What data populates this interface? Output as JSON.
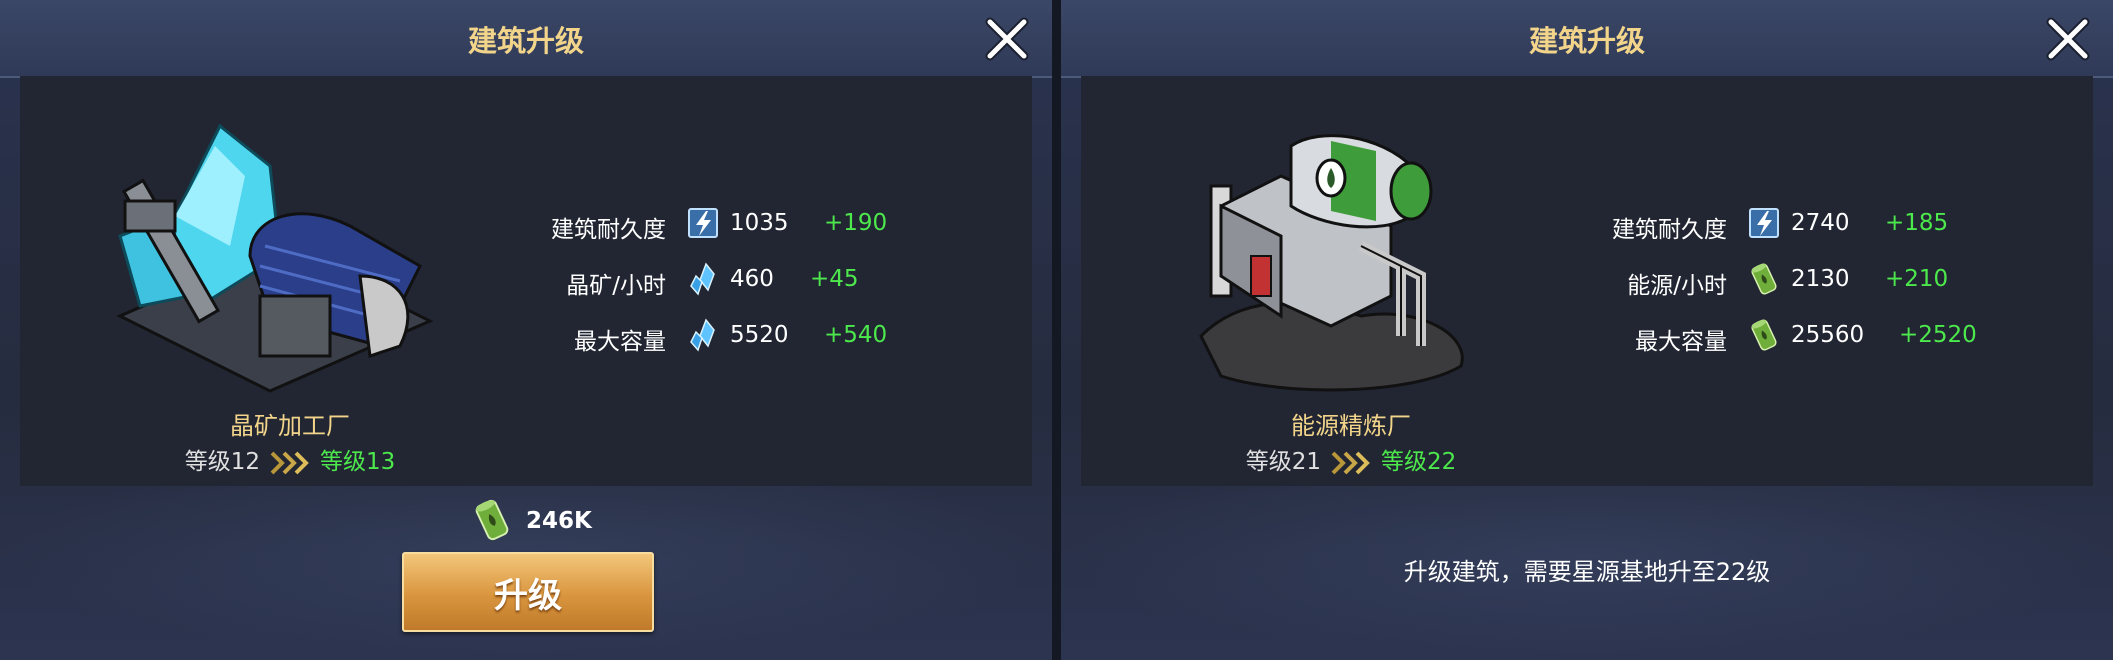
{
  "panels": [
    {
      "title": "建筑升级",
      "building_name": "晶矿加工厂",
      "level_from": "等级12",
      "level_to": "等级13",
      "stats": [
        {
          "label": "建筑耐久度",
          "icon": "durability-icon",
          "value": "1035",
          "bonus": "+190"
        },
        {
          "label": "晶矿/小时",
          "icon": "crystal-icon",
          "value": "460",
          "bonus": "+45"
        },
        {
          "label": "最大容量",
          "icon": "crystal-icon",
          "value": "5520",
          "bonus": "+540"
        }
      ],
      "cost": {
        "icon": "energy-barrel-icon",
        "amount": "246K"
      },
      "button_label": "升级"
    },
    {
      "title": "建筑升级",
      "building_name": "能源精炼厂",
      "level_from": "等级21",
      "level_to": "等级22",
      "stats": [
        {
          "label": "建筑耐久度",
          "icon": "durability-icon",
          "value": "2740",
          "bonus": "+185"
        },
        {
          "label": "能源/小时",
          "icon": "energy-barrel-icon",
          "value": "2130",
          "bonus": "+210"
        },
        {
          "label": "最大容量",
          "icon": "energy-barrel-icon",
          "value": "25560",
          "bonus": "+2520"
        }
      ],
      "requirement": "升级建筑，需要星源基地升至22级"
    }
  ],
  "colors": {
    "title_gold": "#f2d58a",
    "bonus_green": "#4ce84c",
    "button_orange": "#d9953e"
  }
}
